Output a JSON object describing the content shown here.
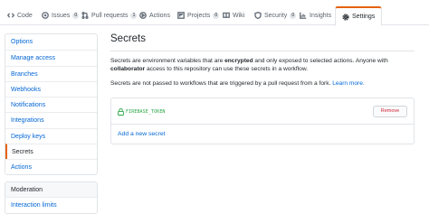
{
  "tabs": [
    {
      "label": "Code",
      "icon": "code-icon"
    },
    {
      "label": "Issues",
      "icon": "issue-icon",
      "count": "0"
    },
    {
      "label": "Pull requests",
      "icon": "pull-request-icon",
      "count": "1"
    },
    {
      "label": "Actions",
      "icon": "play-icon"
    },
    {
      "label": "Projects",
      "icon": "project-icon",
      "count": "0"
    },
    {
      "label": "Wiki",
      "icon": "book-icon"
    },
    {
      "label": "Security",
      "icon": "shield-icon",
      "count": "0"
    },
    {
      "label": "Insights",
      "icon": "graph-icon"
    },
    {
      "label": "Settings",
      "icon": "gear-icon"
    }
  ],
  "sidebar": {
    "items": [
      {
        "label": "Options"
      },
      {
        "label": "Manage access"
      },
      {
        "label": "Branches"
      },
      {
        "label": "Webhooks"
      },
      {
        "label": "Notifications"
      },
      {
        "label": "Integrations"
      },
      {
        "label": "Deploy keys"
      },
      {
        "label": "Secrets"
      },
      {
        "label": "Actions"
      }
    ],
    "selected": "Secrets",
    "moderation": {
      "heading": "Moderation",
      "items": [
        {
          "label": "Interaction limits"
        }
      ]
    }
  },
  "main": {
    "title": "Secrets",
    "description": {
      "part1": "Secrets are environment variables that are ",
      "bold1": "encrypted",
      "part2": " and only exposed to selected actions. Anyone with ",
      "bold2": "collaborator",
      "part3": " access to this repository can use these secrets in a workflow."
    },
    "note": {
      "text": "Secrets are not passed to workflows that are triggered by a pull request from a fork. ",
      "link": "Learn more."
    },
    "secrets": [
      {
        "name": "FIREBASE_TOKEN",
        "remove_label": "Remove"
      }
    ],
    "add_link": "Add a new secret"
  },
  "colors": {
    "accent": "#e36209",
    "link": "#0366d6",
    "danger": "#cb2431",
    "secret_name": "#28a745"
  }
}
